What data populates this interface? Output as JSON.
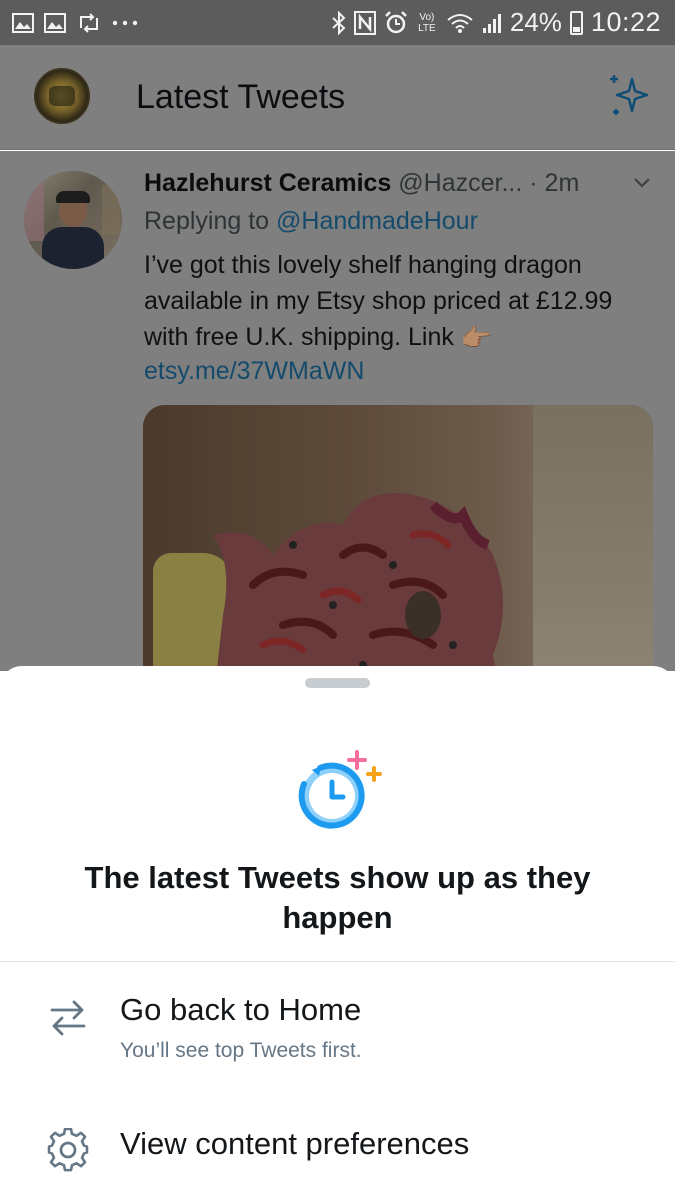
{
  "status_bar": {
    "battery": "24%",
    "time": "10:22",
    "network_label": "Vo) LTE",
    "icons_left": [
      "image-icon",
      "image-icon",
      "retweet-icon",
      "more-dots-icon"
    ],
    "icons_right": [
      "bluetooth-icon",
      "nfc-icon",
      "alarm-icon",
      "volte-icon",
      "wifi-icon",
      "signal-icon",
      "battery-icon"
    ]
  },
  "header": {
    "title": "Latest Tweets",
    "right_icon": "sparkle-icon",
    "accent_color": "#1da1f2"
  },
  "tweet": {
    "author_name": "Hazlehurst Ceramics",
    "author_handle": "@Hazcer...",
    "time": "· 2m",
    "reply_prefix": "Replying to ",
    "reply_handle": "@HandmadeHour",
    "text": "I’ve got this lovely shelf hanging dragon available in my Etsy shop priced at £12.99 with free U.K. shipping. Link",
    "emoji": "👉🏽",
    "link": "etsy.me/37WMaWN"
  },
  "sheet": {
    "title": "The latest Tweets show up as they happen",
    "options": [
      {
        "icon": "swap-arrows-icon",
        "label": "Go back to Home",
        "sub": "You’ll see top Tweets first."
      },
      {
        "icon": "gear-icon",
        "label": "View content preferences",
        "sub": ""
      }
    ]
  },
  "colors": {
    "overlay": "#7f7f7f",
    "link": "#1da1f2",
    "secondary_text": "#657786"
  }
}
